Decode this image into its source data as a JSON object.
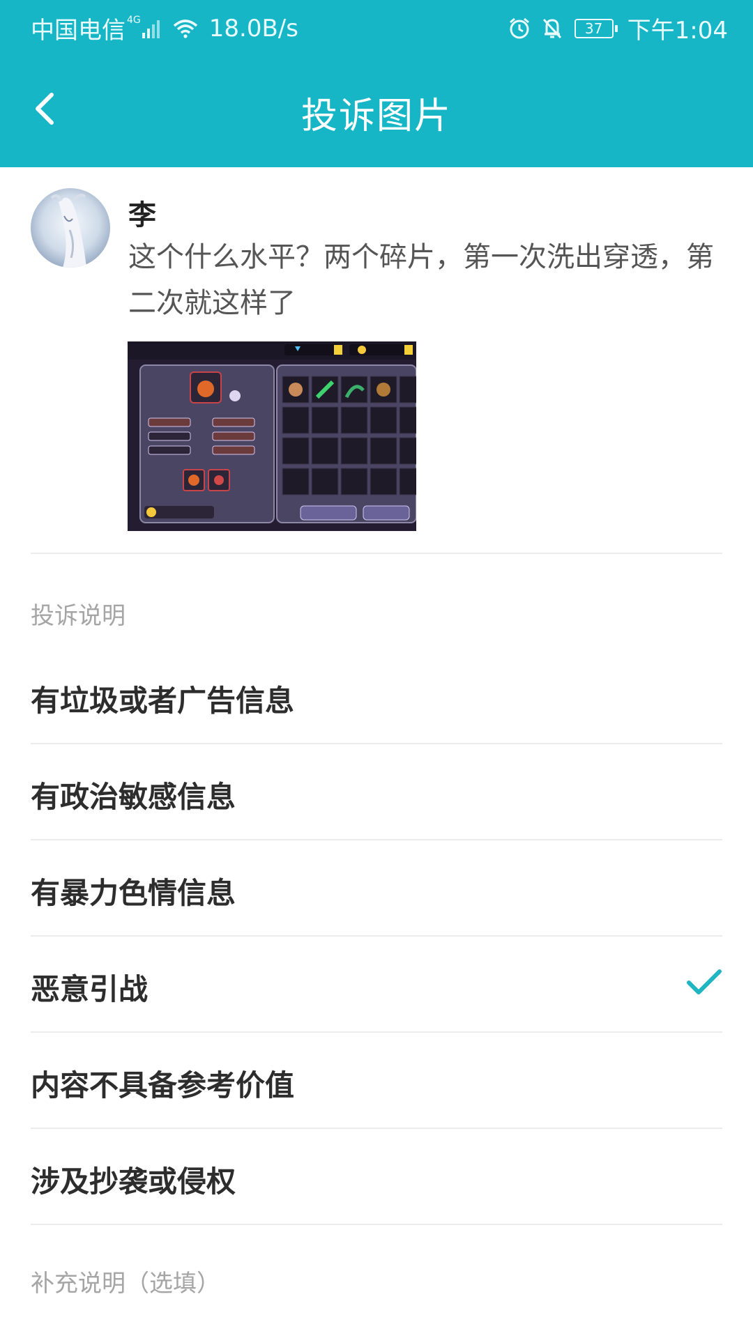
{
  "status_bar": {
    "carrier": "中国电信",
    "network": "4G",
    "speed": "18.0B/s",
    "battery": "37",
    "time": "下午1:04"
  },
  "header": {
    "title": "投诉图片",
    "back_icon": "chevron-left-icon"
  },
  "post": {
    "author": "李",
    "text": "这个什么水平？两个碎片，第一次洗出穿透，第二次就这样了"
  },
  "complaint": {
    "section_label": "投诉说明",
    "options": [
      {
        "label": "有垃圾或者广告信息",
        "selected": false
      },
      {
        "label": "有政治敏感信息",
        "selected": false
      },
      {
        "label": "有暴力色情信息",
        "selected": false
      },
      {
        "label": "恶意引战",
        "selected": true
      },
      {
        "label": "内容不具备参考价值",
        "selected": false
      },
      {
        "label": "涉及抄袭或侵权",
        "selected": false
      }
    ],
    "supplement_label": "补充说明（选填）"
  },
  "colors": {
    "accent": "#16b6c6",
    "check": "#1fb5c2"
  }
}
